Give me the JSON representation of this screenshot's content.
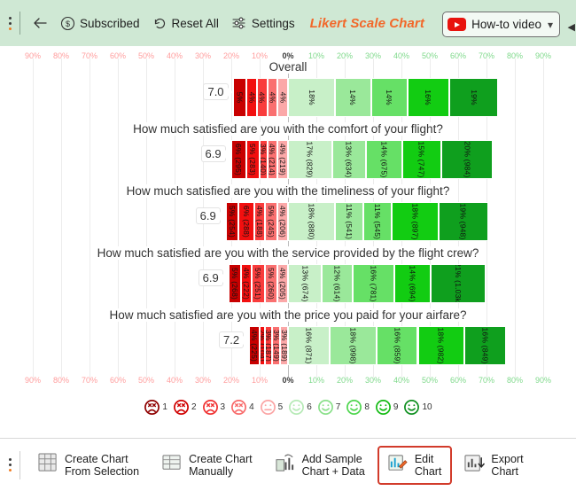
{
  "toolbar": {
    "kebab": "more-options",
    "back": "back-arrow",
    "subscribed": "Subscribed",
    "reset_all": "Reset All",
    "settings": "Settings",
    "chart_title": "Likert Scale Chart",
    "howto": "How-to video",
    "chevron": "∨"
  },
  "bottom_bar": {
    "buttons": [
      {
        "name": "create-chart-from-selection",
        "line1": "Create Chart",
        "line2": "From Selection",
        "icon": "grid-icon",
        "selected": false
      },
      {
        "name": "create-chart-manually",
        "line1": "Create Chart",
        "line2": "Manually",
        "icon": "table-icon",
        "selected": false
      },
      {
        "name": "add-sample-chart-data",
        "line1": "Add Sample",
        "line2": "Chart + Data",
        "icon": "sample-data-icon",
        "selected": false
      },
      {
        "name": "edit-chart",
        "line1": "Edit",
        "line2": "Chart",
        "icon": "edit-chart-icon",
        "selected": true
      },
      {
        "name": "export-chart",
        "line1": "Export",
        "line2": "Chart",
        "icon": "export-icon",
        "selected": false
      }
    ]
  },
  "chart_data": {
    "type": "bar",
    "subtype": "diverging-stacked-likert",
    "title": "Likert Scale Chart",
    "xlabel": "",
    "ylabel": "",
    "xlim": [
      -100,
      100
    ],
    "grid": true,
    "legend_position": "bottom",
    "axis_ticks": [
      {
        "label": "90%",
        "side": "neg"
      },
      {
        "label": "80%",
        "side": "neg"
      },
      {
        "label": "70%",
        "side": "neg"
      },
      {
        "label": "60%",
        "side": "neg"
      },
      {
        "label": "50%",
        "side": "neg"
      },
      {
        "label": "40%",
        "side": "neg"
      },
      {
        "label": "30%",
        "side": "neg"
      },
      {
        "label": "20%",
        "side": "neg"
      },
      {
        "label": "10%",
        "side": "neg"
      },
      {
        "label": "0%",
        "side": "zero"
      },
      {
        "label": "10%",
        "side": "pos"
      },
      {
        "label": "20%",
        "side": "pos"
      },
      {
        "label": "30%",
        "side": "pos"
      },
      {
        "label": "40%",
        "side": "pos"
      },
      {
        "label": "50%",
        "side": "pos"
      },
      {
        "label": "60%",
        "side": "pos"
      },
      {
        "label": "70%",
        "side": "pos"
      },
      {
        "label": "80%",
        "side": "pos"
      },
      {
        "label": "90%",
        "side": "pos"
      }
    ],
    "scale_colors": [
      "#c80000",
      "#f20f0f",
      "#f93c3c",
      "#fa7070",
      "#fba8a8",
      "#c8f0c8",
      "#9ae89a",
      "#66e066",
      "#12cc12",
      "#0f9f1e"
    ],
    "legend": [
      {
        "num": "1",
        "face": "sad",
        "color": "#8f0000"
      },
      {
        "num": "2",
        "face": "sad",
        "color": "#d00000"
      },
      {
        "num": "3",
        "face": "sad",
        "color": "#f03030"
      },
      {
        "num": "4",
        "face": "sad",
        "color": "#f86a6a"
      },
      {
        "num": "5",
        "face": "neutral",
        "color": "#fba6a6"
      },
      {
        "num": "6",
        "face": "happy",
        "color": "#b6eab6"
      },
      {
        "num": "7",
        "face": "happy",
        "color": "#8ae08a"
      },
      {
        "num": "8",
        "face": "happy",
        "color": "#4fd64f"
      },
      {
        "num": "9",
        "face": "happy",
        "color": "#14bb14"
      },
      {
        "num": "10",
        "face": "happy",
        "color": "#0f9020"
      }
    ],
    "rows": [
      {
        "label": "Overall",
        "score": "7.0",
        "values": [
          {
            "pct": 5,
            "text": "5%"
          },
          {
            "pct": 4,
            "text": "4%"
          },
          {
            "pct": 4,
            "text": "4%"
          },
          {
            "pct": 4,
            "text": "4%"
          },
          {
            "pct": 4,
            "text": "4%"
          },
          {
            "pct": 18,
            "text": "18%"
          },
          {
            "pct": 14,
            "text": "14%"
          },
          {
            "pct": 14,
            "text": "14%"
          },
          {
            "pct": 16,
            "text": "16%"
          },
          {
            "pct": 19,
            "text": "19%"
          }
        ]
      },
      {
        "label": "How much satisfied are you with the comfort of your flight?",
        "score": "6.9",
        "values": [
          {
            "pct": 6,
            "text": "6% (295)"
          },
          {
            "pct": 5,
            "text": "5% (283)"
          },
          {
            "pct": 3,
            "text": "3% (140)"
          },
          {
            "pct": 4,
            "text": "4% (214)"
          },
          {
            "pct": 4,
            "text": "4% (219)"
          },
          {
            "pct": 17,
            "text": "17% (829)"
          },
          {
            "pct": 13,
            "text": "13% (634)"
          },
          {
            "pct": 14,
            "text": "14% (675)"
          },
          {
            "pct": 15,
            "text": "15% (747)"
          },
          {
            "pct": 20,
            "text": "20% (984)"
          }
        ]
      },
      {
        "label": "How much satisfied are you with the timeliness of your flight?",
        "score": "6.9",
        "values": [
          {
            "pct": 5,
            "text": "5% (254)"
          },
          {
            "pct": 6,
            "text": "6% (288)"
          },
          {
            "pct": 4,
            "text": "4% (188)"
          },
          {
            "pct": 5,
            "text": "5% (245)"
          },
          {
            "pct": 4,
            "text": "4% (206)"
          },
          {
            "pct": 18,
            "text": "18% (880)"
          },
          {
            "pct": 11,
            "text": "11% (541)"
          },
          {
            "pct": 11,
            "text": "11% (545)"
          },
          {
            "pct": 18,
            "text": "18% (897)"
          },
          {
            "pct": 19,
            "text": "19% (948)"
          }
        ]
      },
      {
        "label": "How much satisfied are you with the service provided by the flight crew?",
        "score": "6.9",
        "values": [
          {
            "pct": 5,
            "text": "5% (268)"
          },
          {
            "pct": 4,
            "text": "4% (222)"
          },
          {
            "pct": 5,
            "text": "5% (251)"
          },
          {
            "pct": 5,
            "text": "5% (260)"
          },
          {
            "pct": 4,
            "text": "4% (205)"
          },
          {
            "pct": 13,
            "text": "13% (674)"
          },
          {
            "pct": 12,
            "text": "12% (614)"
          },
          {
            "pct": 16,
            "text": "16% (781)"
          },
          {
            "pct": 14,
            "text": "14% (694)"
          },
          {
            "pct": 21,
            "text": "21% (1.03k)"
          }
        ]
      },
      {
        "label": "How much satisfied are you with the price you paid for your airfare?",
        "score": "7.2",
        "values": [
          {
            "pct": 4,
            "text": "4% (225)"
          },
          {
            "pct": 2,
            "text": "2% (104)"
          },
          {
            "pct": 3,
            "text": "3% (187)"
          },
          {
            "pct": 3,
            "text": "3% (149)"
          },
          {
            "pct": 3,
            "text": "3% (189)"
          },
          {
            "pct": 16,
            "text": "16% (871)"
          },
          {
            "pct": 18,
            "text": "18% (998)"
          },
          {
            "pct": 16,
            "text": "16% (859)"
          },
          {
            "pct": 18,
            "text": "18% (982)"
          },
          {
            "pct": 16,
            "text": "16% (849)"
          }
        ]
      }
    ]
  }
}
